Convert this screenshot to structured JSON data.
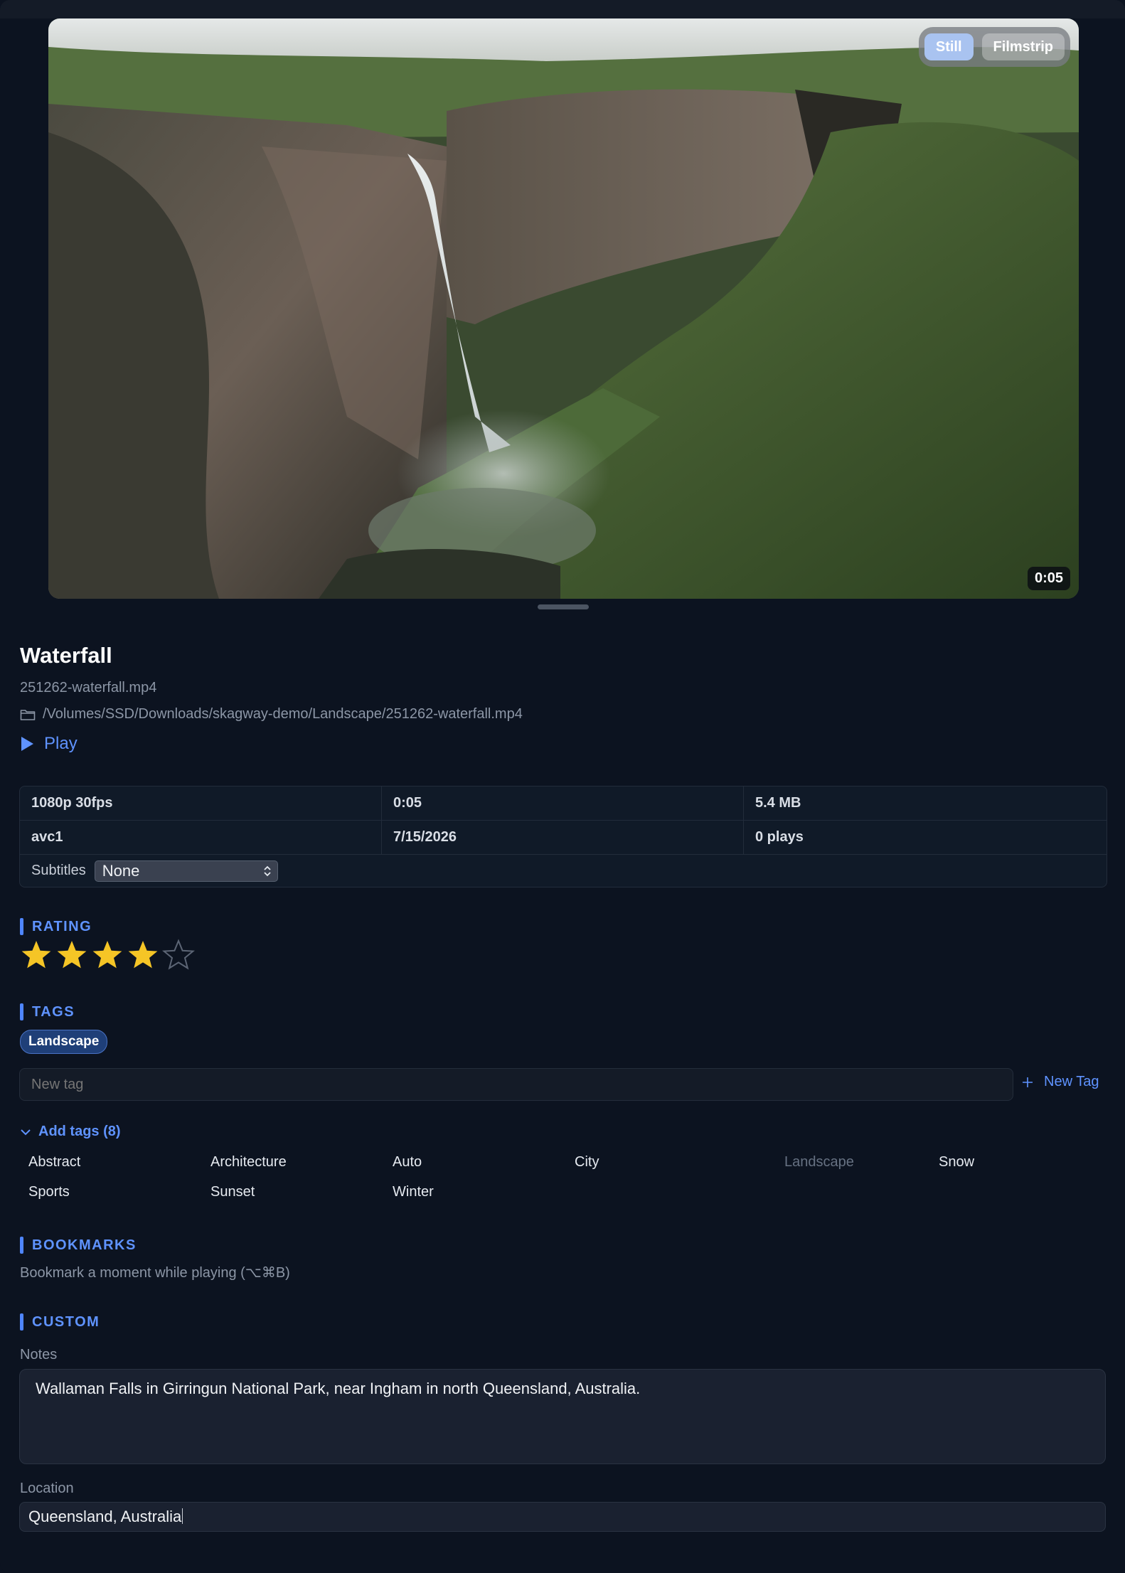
{
  "preview": {
    "view_modes": [
      "Still",
      "Filmstrip"
    ],
    "active_mode": "Still",
    "duration": "0:05"
  },
  "video": {
    "title": "Waterfall",
    "filename": "251262-waterfall.mp4",
    "path": "/Volumes/SSD/Downloads/skagway-demo/Landscape/251262-waterfall.mp4",
    "play_label": "Play"
  },
  "meta": {
    "rows": [
      [
        "1080p 30fps",
        "0:05",
        "5.4 MB"
      ],
      [
        "avc1",
        "7/15/2026",
        "0 plays"
      ]
    ],
    "subtitles_label": "Subtitles",
    "subtitles_value": "None"
  },
  "rating": {
    "heading": "RATING",
    "value": 4,
    "max": 5
  },
  "tags": {
    "heading": "TAGS",
    "applied": [
      "Landscape"
    ],
    "new_tag_placeholder": "New tag",
    "new_tag_button": "New Tag",
    "add_tags_label": "Add tags (8)",
    "available": [
      "Abstract",
      "Architecture",
      "Auto",
      "City",
      "Landscape",
      "Snow",
      "Sports",
      "Sunset",
      "Winter"
    ],
    "disabled": [
      "Landscape"
    ]
  },
  "bookmarks": {
    "heading": "BOOKMARKS",
    "hint": "Bookmark a moment while playing (⌥⌘B)"
  },
  "custom": {
    "heading": "CUSTOM",
    "notes_label": "Notes",
    "notes_value": "Wallaman Falls in Girringun National Park, near Ingham in north Queensland, Australia.",
    "location_label": "Location",
    "location_value": "Queensland, Australia"
  },
  "colors": {
    "background": "#0c1320",
    "accent": "#5f93ff",
    "star_filled": "#f5c526",
    "tag_chip": "#1f3f78"
  },
  "icons": [
    "folder-icon",
    "play-icon",
    "star-icon",
    "plus-icon",
    "chevron-down-icon",
    "select-arrows-icon"
  ]
}
